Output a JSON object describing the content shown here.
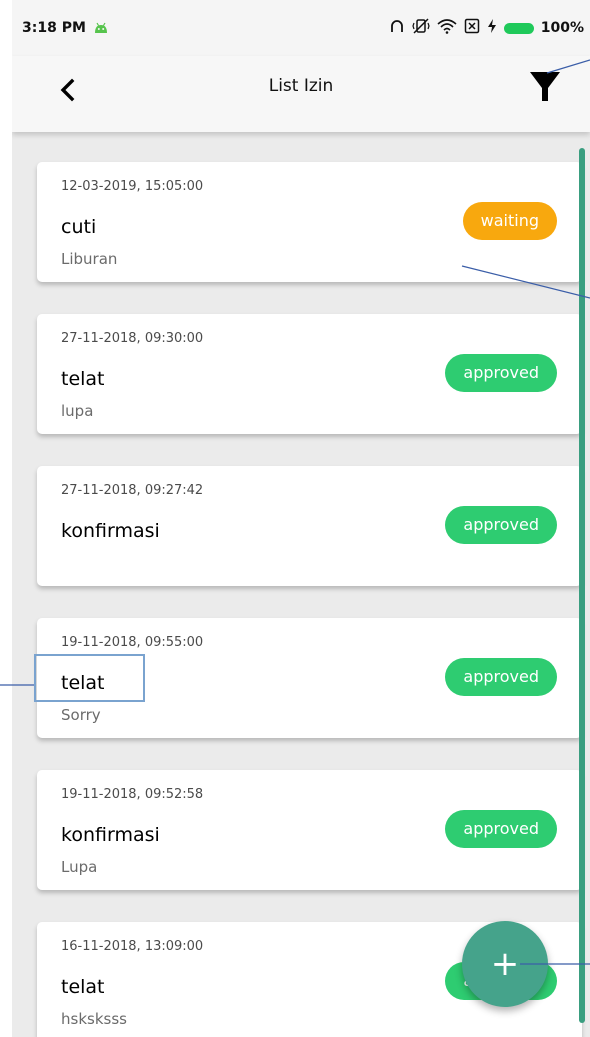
{
  "status_bar": {
    "time": "3:18 PM",
    "battery": "100%",
    "icons": [
      "android-icon",
      "headphones-icon",
      "vibrate-off-icon",
      "wifi-icon",
      "sim-off-icon",
      "charging-bolt-icon",
      "battery-icon"
    ]
  },
  "app_bar": {
    "title": "List Izin",
    "back_icon": "chevron-left-icon",
    "filter_icon": "filter-icon"
  },
  "items": [
    {
      "date": "12-03-2019, 15:05:00",
      "type": "cuti",
      "reason": "Liburan",
      "status": "waiting",
      "color": "#f8a80e"
    },
    {
      "date": "27-11-2018, 09:30:00",
      "type": "telat",
      "reason": "lupa",
      "status": "approved",
      "color": "#2ecc71"
    },
    {
      "date": "27-11-2018, 09:27:42",
      "type": "konfirmasi",
      "reason": "",
      "status": "approved",
      "color": "#2ecc71"
    },
    {
      "date": "19-11-2018, 09:55:00",
      "type": "telat",
      "reason": "Sorry",
      "status": "approved",
      "color": "#2ecc71"
    },
    {
      "date": "19-11-2018, 09:52:58",
      "type": "konfirmasi",
      "reason": "Lupa",
      "status": "approved",
      "color": "#2ecc71"
    },
    {
      "date": "16-11-2018, 13:09:00",
      "type": "telat",
      "reason": "hsksksss",
      "status": "approved",
      "color": "#2ecc71"
    }
  ],
  "fab": {
    "symbol": "+",
    "icon": "plus-icon",
    "color": "#45a38b"
  },
  "colors": {
    "scrollbar": "#3a9e80",
    "annotation": "#3b5ea8"
  }
}
